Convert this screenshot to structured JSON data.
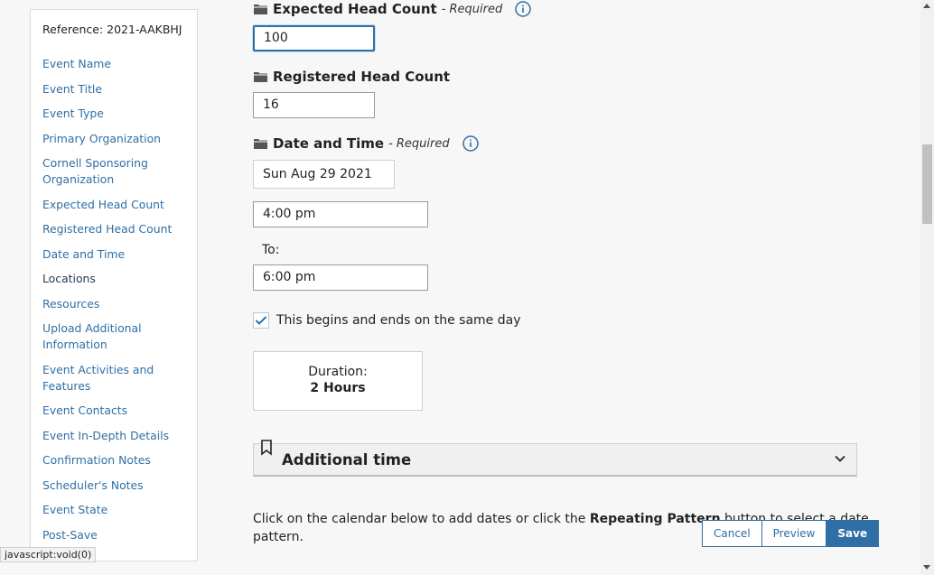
{
  "nav": {
    "reference": "Reference: 2021-AAKBHJ",
    "items": [
      {
        "label": "Event Name"
      },
      {
        "label": "Event Title"
      },
      {
        "label": "Event Type"
      },
      {
        "label": "Primary Organization"
      },
      {
        "label": "Cornell Sponsoring Organization"
      },
      {
        "label": "Expected Head Count"
      },
      {
        "label": "Registered Head Count"
      },
      {
        "label": "Date and Time"
      },
      {
        "label": "Locations"
      },
      {
        "label": "Resources"
      },
      {
        "label": "Upload Additional Information"
      },
      {
        "label": "Event Activities and Features"
      },
      {
        "label": "Event Contacts"
      },
      {
        "label": "Event In-Depth Details"
      },
      {
        "label": "Confirmation Notes"
      },
      {
        "label": "Scheduler's Notes"
      },
      {
        "label": "Event State"
      },
      {
        "label": "Post-Save"
      }
    ]
  },
  "expected_head_count": {
    "title": "Expected Head Count",
    "required": "- Required",
    "value": "100"
  },
  "registered_head_count": {
    "title": "Registered Head Count",
    "value": "16"
  },
  "date_time": {
    "title": "Date and Time",
    "required": "- Required",
    "date": "Sun Aug 29 2021",
    "start_time": "4:00 pm",
    "to_label": "To:",
    "end_time": "6:00 pm",
    "same_day_label": "This begins and ends on the same day",
    "same_day_checked": true,
    "duration_label": "Duration:",
    "duration_value": "2 Hours"
  },
  "additional_time": {
    "title": "Additional time"
  },
  "help": {
    "part1": "Click on the calendar below to add dates or click the ",
    "bold": "Repeating Pattern",
    "part2": " button to select a date",
    "part3": "pattern."
  },
  "buttons": {
    "cancel": "Cancel",
    "preview": "Preview",
    "save": "Save"
  },
  "statusbar": {
    "text": "javascript:void(0)"
  },
  "colors": {
    "link": "#2f6fa5",
    "primary": "#2f6fa5",
    "background": "#f7f7f7"
  }
}
